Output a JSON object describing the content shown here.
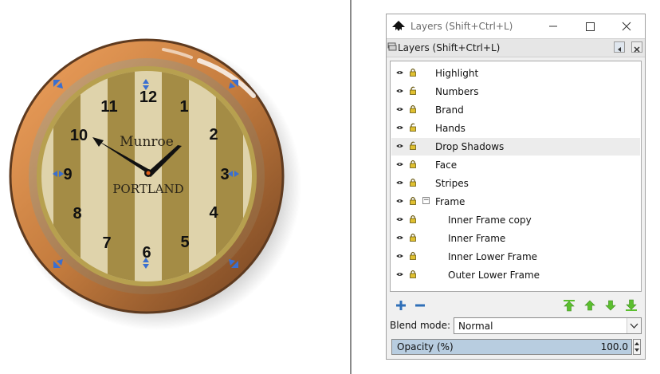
{
  "canvas": {
    "clock": {
      "brand_top": "Munroe",
      "brand_bottom": "PORTLAND",
      "numerals": [
        "12",
        "1",
        "2",
        "3",
        "4",
        "5",
        "6",
        "7",
        "8",
        "9",
        "10",
        "11"
      ]
    }
  },
  "window": {
    "title": "Layers (Shift+Ctrl+L)",
    "dock_title": "Layers (Shift+Ctrl+L)"
  },
  "layers": [
    {
      "name": "Highlight",
      "locked": true,
      "indent": 0
    },
    {
      "name": "Numbers",
      "locked": false,
      "indent": 0
    },
    {
      "name": "Brand",
      "locked": true,
      "indent": 0
    },
    {
      "name": "Hands",
      "locked": false,
      "indent": 0
    },
    {
      "name": "Drop Shadows",
      "locked": false,
      "indent": 0,
      "selected": true
    },
    {
      "name": "Face",
      "locked": true,
      "indent": 0
    },
    {
      "name": "Stripes",
      "locked": true,
      "indent": 0
    },
    {
      "name": "Frame",
      "locked": true,
      "indent": 0,
      "expanded": true
    },
    {
      "name": "Inner Frame copy",
      "locked": true,
      "indent": 1
    },
    {
      "name": "Inner Frame",
      "locked": true,
      "indent": 1
    },
    {
      "name": "Inner Lower Frame",
      "locked": true,
      "indent": 1
    },
    {
      "name": "Outer Lower Frame",
      "locked": true,
      "indent": 1
    }
  ],
  "footer": {
    "blend_label": "Blend mode:",
    "blend_value": "Normal",
    "opacity_label": "Opacity (%)",
    "opacity_value": "100.0"
  },
  "colors": {
    "frame": "#8a5a33",
    "face_light": "#dfd3ab",
    "face_dark": "#a48c45",
    "accent_green": "#5bbf2e",
    "accent_blue": "#3a6fd0"
  }
}
